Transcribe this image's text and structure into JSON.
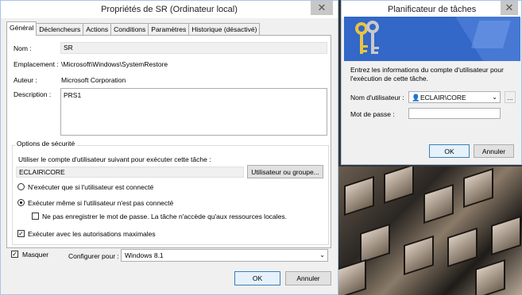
{
  "main_dialog": {
    "title": "Propriétés de SR (Ordinateur local)",
    "close": "✕",
    "tabs": [
      "Général",
      "Déclencheurs",
      "Actions",
      "Conditions",
      "Paramètres",
      "Historique (désactivé)"
    ],
    "fields": {
      "name_label": "Nom :",
      "name_value": "SR",
      "location_label": "Emplacement :",
      "location_value": "\\Microsoft\\Windows\\SystemRestore",
      "author_label": "Auteur :",
      "author_value": "Microsoft Corporation",
      "description_label": "Description :",
      "description_value": "PRS1"
    },
    "security": {
      "group_title": "Options de sécurité",
      "account_prompt": "Utiliser le compte d'utilisateur suivant pour exécuter cette tâche :",
      "account_value": "ECLAIR\\CORE",
      "user_group_button": "Utilisateur ou groupe...",
      "radio_logged_on": "N'exécuter que si l'utilisateur est connecté",
      "radio_always": "Exécuter même si l'utilisateur n'est pas connecté",
      "no_store_password": "Ne pas enregistrer le mot de passe. La tâche n'accède qu'aux ressources locales.",
      "highest_privileges": "Exécuter avec les autorisations maximales"
    },
    "hidden_label": "Masquer",
    "configure_label": "Configurer pour :",
    "configure_value": "Windows 8.1",
    "ok": "OK",
    "cancel": "Annuler"
  },
  "scheduler_dialog": {
    "title": "Planificateur de tâches",
    "close": "✕",
    "prompt": "Entrez les informations du compte d'utilisateur pour l'exécution de cette tâche.",
    "username_label": "Nom d'utilisateur :",
    "username_value": "ECLAIR\\CORE",
    "password_label": "Mot de passe :",
    "password_value": "",
    "browse": "...",
    "ok": "OK",
    "cancel": "Annuler"
  },
  "colors": {
    "banner": "#3367c8",
    "titlebar_close": "#c7c7c7",
    "window_border": "#a7c6e6"
  }
}
